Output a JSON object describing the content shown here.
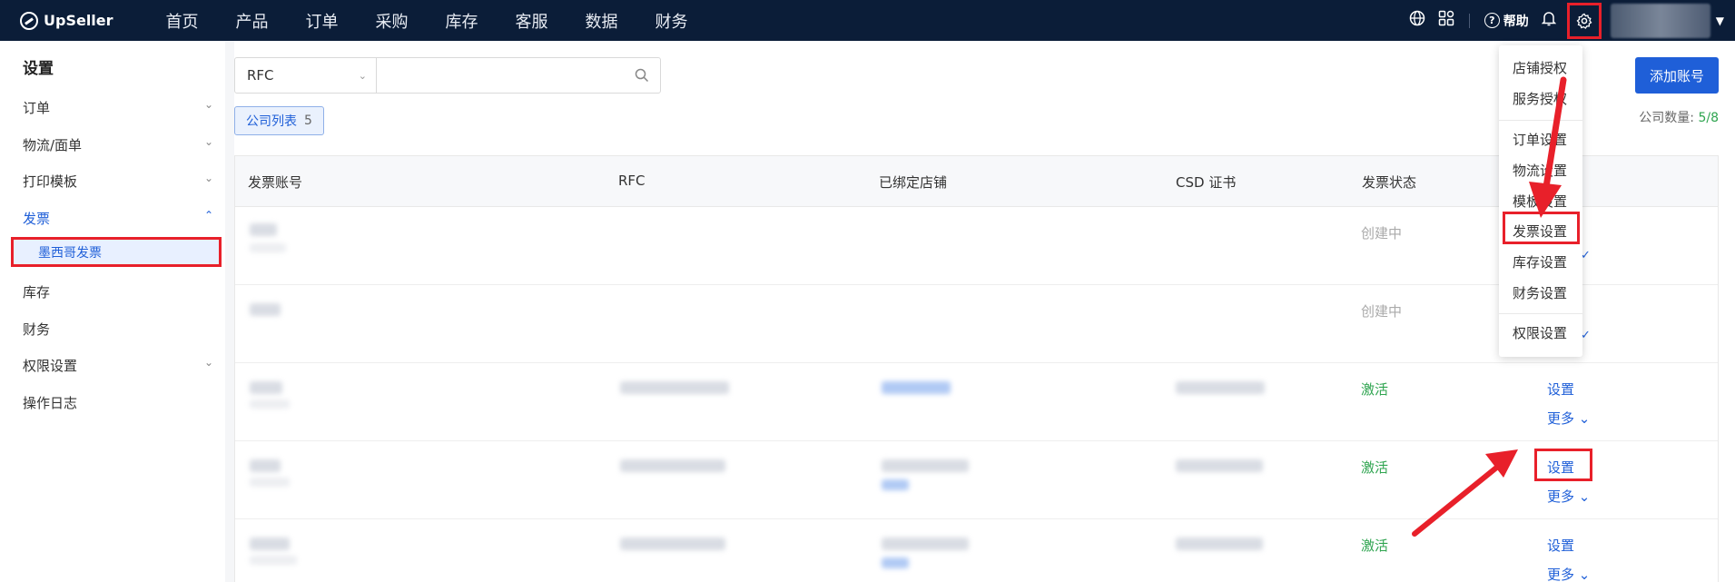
{
  "app": {
    "logo_text": "UpSeller"
  },
  "nav": [
    "首页",
    "产品",
    "订单",
    "采购",
    "库存",
    "客服",
    "数据",
    "财务"
  ],
  "top_right": {
    "help_label": "帮助"
  },
  "sidebar": {
    "title": "设置",
    "items": [
      {
        "label": "订单",
        "chevron": "down"
      },
      {
        "label": "物流/面单",
        "chevron": "down"
      },
      {
        "label": "打印模板",
        "chevron": "down"
      },
      {
        "label": "发票",
        "chevron": "up",
        "active": true
      },
      {
        "label": "库存"
      },
      {
        "label": "财务"
      },
      {
        "label": "权限设置",
        "chevron": "down"
      },
      {
        "label": "操作日志"
      }
    ],
    "sub_item": "墨西哥发票"
  },
  "search": {
    "field": "RFC",
    "placeholder": ""
  },
  "tab": {
    "label": "公司列表",
    "count": "5"
  },
  "add_button": "添加账号",
  "company_count": {
    "label": "公司数量:",
    "value": "5/8"
  },
  "table": {
    "headers": [
      "发票账号",
      "RFC",
      "已绑定店铺",
      "CSD 证书",
      "发票状态"
    ],
    "rows": [
      {
        "status": "创建中",
        "status_type": "pending"
      },
      {
        "status": "创建中",
        "status_type": "pending"
      },
      {
        "status": "激活",
        "status_type": "active",
        "action": "设置",
        "more": "更多"
      },
      {
        "status": "激活",
        "status_type": "active",
        "action": "设置",
        "more": "更多"
      },
      {
        "status": "激活",
        "status_type": "active",
        "action": "设置",
        "more": "更多"
      }
    ]
  },
  "settings_menu": {
    "group1": [
      "店铺授权",
      "服务授权"
    ],
    "group2": [
      "订单设置",
      "物流设置",
      "模板设置",
      "发票设置",
      "库存设置",
      "财务设置"
    ],
    "group3": [
      "权限设置"
    ]
  },
  "colors": {
    "accent": "#1f5fd8",
    "highlight": "#e8202a",
    "topbar": "#0b1d38",
    "active_status": "#2ea44f"
  }
}
